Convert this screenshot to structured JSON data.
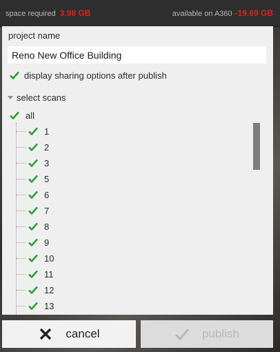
{
  "header": {
    "space_label": "space required",
    "space_value": "3.98 GB",
    "available_label": "available on A360",
    "available_value": "-19.69 GB"
  },
  "project": {
    "label": "project name",
    "name": "Reno New Office Building"
  },
  "sharing": {
    "label": "display sharing options after publish",
    "checked": true
  },
  "scans": {
    "section_label": "select scans",
    "all_label": "all",
    "items": [
      "1",
      "2",
      "3",
      "5",
      "6",
      "7",
      "8",
      "9",
      "10",
      "11",
      "12",
      "13"
    ]
  },
  "buttons": {
    "cancel": "cancel",
    "publish": "publish"
  },
  "colors": {
    "check": "#2e9e2e",
    "warning": "#e0211b"
  },
  "icons": {
    "check": "check-icon",
    "close": "close-icon",
    "caret": "caret-down-icon"
  }
}
